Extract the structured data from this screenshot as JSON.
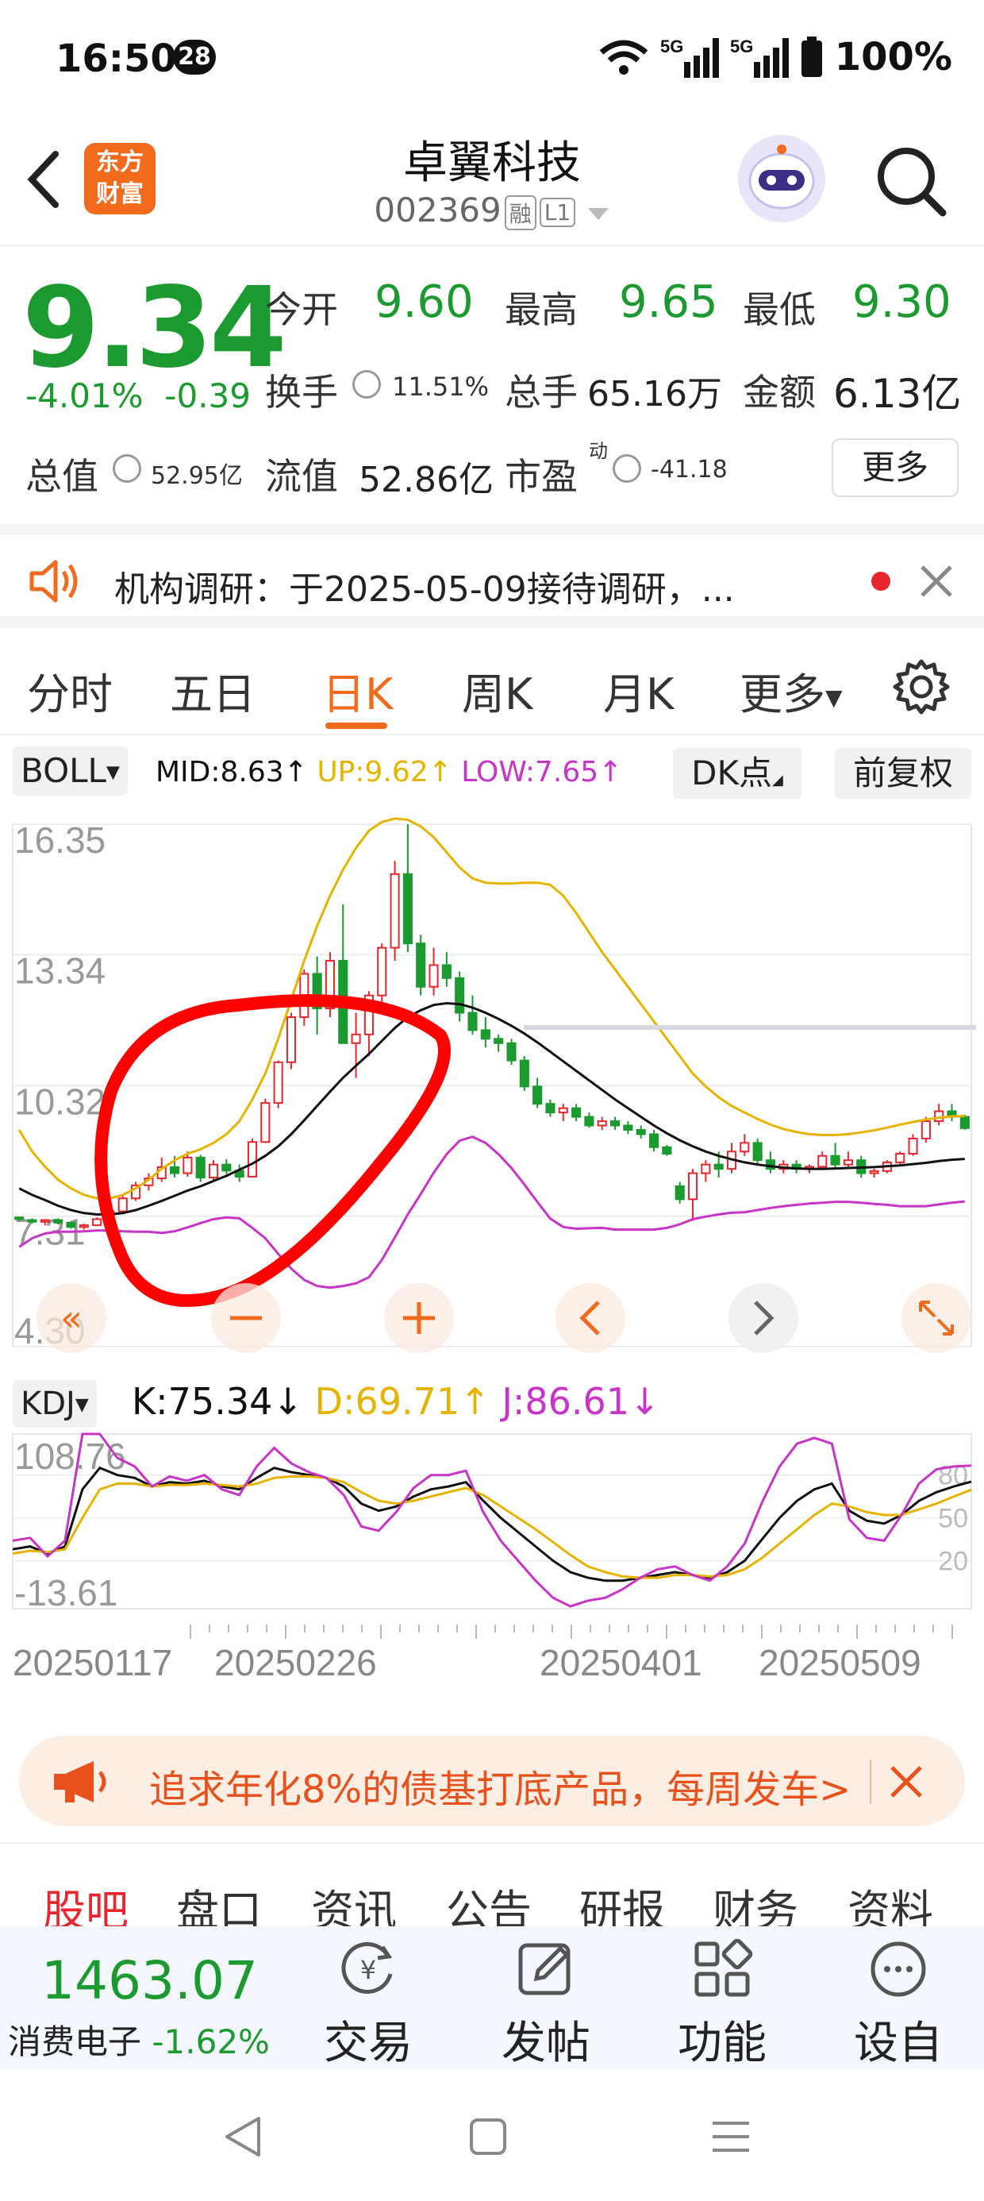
{
  "status": {
    "time": "16:50",
    "badge": "28",
    "network": "5G",
    "battery": "100%"
  },
  "header": {
    "title": "卓翼科技",
    "code": "002369",
    "tag_margin": "融",
    "tag_level": "L1",
    "logo_line1": "东方",
    "logo_line2": "财富"
  },
  "quote": {
    "price": "9.34",
    "change_pct": "-4.01%",
    "change": "-0.39",
    "open_label": "今开",
    "open": "9.60",
    "high_label": "最高",
    "high": "9.65",
    "low_label": "最低",
    "low": "9.30",
    "turnover_label": "换手",
    "turnover": "11.51%",
    "volume_label": "总手",
    "volume": "65.16万",
    "amount_label": "金额",
    "amount": "6.13亿",
    "mktcap_label": "总值",
    "mktcap": "52.95亿",
    "float_label": "流值",
    "float": "52.86亿",
    "pe_label": "市盈",
    "pe_sup": "动",
    "pe": "-41.18",
    "more": "更多"
  },
  "notice": {
    "text": "机构调研：于2025-05-09接待调研，..."
  },
  "tabs": [
    "分时",
    "五日",
    "日K",
    "周K",
    "月K",
    "更多"
  ],
  "indicator": {
    "name": "BOLL",
    "mid": "MID:8.63↑",
    "up": "UP:9.62↑",
    "low": "LOW:7.65↑",
    "dk": "DK点",
    "adjust": "前复权",
    "colors": {
      "mid": "#111111",
      "up": "#e6b400",
      "low": "#c833c8",
      "up_candle": "#e8262e",
      "down_candle": "#1a9a2f"
    }
  },
  "kdj": {
    "name": "KDJ",
    "k": "K:75.34↓",
    "d": "D:69.71↑",
    "j": "J:86.61↓"
  },
  "chart_data": [
    {
      "type": "candlestick",
      "indicator": "BOLL",
      "y_tick_labels": [
        "16.35",
        "13.34",
        "10.32",
        "7.31",
        "4.30"
      ],
      "ylim": [
        4.3,
        16.35
      ],
      "x_tick_labels": [
        "20250117",
        "20250226",
        "20250401",
        "20250509"
      ],
      "ohlc": [
        [
          7.28,
          7.3,
          7.2,
          7.25
        ],
        [
          7.22,
          7.26,
          7.14,
          7.18
        ],
        [
          7.18,
          7.24,
          7.1,
          7.22
        ],
        [
          7.22,
          7.26,
          7.12,
          7.16
        ],
        [
          7.16,
          7.2,
          7.02,
          7.06
        ],
        [
          7.06,
          7.14,
          7.0,
          7.1
        ],
        [
          7.1,
          7.28,
          7.08,
          7.24
        ],
        [
          7.24,
          7.48,
          7.2,
          7.42
        ],
        [
          7.42,
          7.8,
          7.38,
          7.72
        ],
        [
          7.72,
          8.1,
          7.66,
          8.02
        ],
        [
          8.02,
          8.3,
          7.9,
          8.18
        ],
        [
          8.18,
          8.66,
          8.1,
          8.44
        ],
        [
          8.44,
          8.7,
          8.2,
          8.3
        ],
        [
          8.3,
          8.8,
          8.22,
          8.66
        ],
        [
          8.66,
          8.72,
          8.1,
          8.2
        ],
        [
          8.2,
          8.6,
          8.1,
          8.5
        ],
        [
          8.5,
          8.62,
          8.28,
          8.36
        ],
        [
          8.36,
          8.5,
          8.1,
          8.22
        ],
        [
          8.22,
          9.1,
          8.2,
          9.02
        ],
        [
          9.02,
          10.02,
          9.0,
          9.92
        ],
        [
          9.92,
          10.9,
          9.8,
          10.86
        ],
        [
          10.86,
          12.0,
          10.7,
          11.9
        ],
        [
          11.9,
          13.0,
          11.7,
          12.9
        ],
        [
          12.9,
          13.3,
          11.5,
          12.1
        ],
        [
          12.1,
          13.4,
          11.9,
          13.2
        ],
        [
          13.2,
          14.5,
          11.3,
          11.3
        ],
        [
          11.3,
          12.0,
          10.5,
          11.5
        ],
        [
          11.5,
          12.5,
          11.0,
          12.4
        ],
        [
          12.4,
          13.6,
          12.2,
          13.5
        ],
        [
          13.5,
          15.5,
          13.2,
          15.2
        ],
        [
          15.2,
          16.35,
          13.4,
          13.6
        ],
        [
          13.6,
          13.8,
          12.4,
          12.6
        ],
        [
          12.6,
          13.5,
          12.4,
          13.1
        ],
        [
          13.1,
          13.4,
          12.6,
          12.8
        ],
        [
          12.8,
          12.95,
          11.8,
          12.0
        ],
        [
          12.0,
          12.4,
          11.5,
          11.6
        ],
        [
          11.6,
          11.9,
          11.2,
          11.4
        ],
        [
          11.4,
          11.5,
          11.1,
          11.3
        ],
        [
          11.3,
          11.4,
          10.8,
          10.9
        ],
        [
          10.9,
          11.0,
          10.2,
          10.3
        ],
        [
          10.3,
          10.5,
          9.8,
          9.9
        ],
        [
          9.9,
          10.0,
          9.6,
          9.7
        ],
        [
          9.7,
          9.9,
          9.5,
          9.8
        ],
        [
          9.8,
          9.9,
          9.5,
          9.6
        ],
        [
          9.6,
          9.7,
          9.35,
          9.4
        ],
        [
          9.4,
          9.6,
          9.3,
          9.5
        ],
        [
          9.5,
          9.6,
          9.3,
          9.4
        ],
        [
          9.4,
          9.5,
          9.2,
          9.3
        ],
        [
          9.3,
          9.4,
          9.1,
          9.2
        ],
        [
          9.2,
          9.3,
          8.8,
          8.9
        ],
        [
          8.9,
          8.95,
          8.7,
          8.75
        ],
        [
          8.0,
          8.1,
          7.6,
          7.7
        ],
        [
          7.7,
          8.4,
          7.2,
          8.3
        ],
        [
          8.3,
          8.6,
          8.1,
          8.5
        ],
        [
          8.5,
          8.8,
          8.2,
          8.4
        ],
        [
          8.4,
          9.0,
          8.3,
          8.8
        ],
        [
          8.8,
          9.2,
          8.7,
          9.0
        ],
        [
          9.0,
          9.1,
          8.5,
          8.6
        ],
        [
          8.6,
          8.8,
          8.3,
          8.4
        ],
        [
          8.4,
          8.6,
          8.3,
          8.5
        ],
        [
          8.5,
          8.6,
          8.3,
          8.4
        ],
        [
          8.4,
          8.5,
          8.3,
          8.45
        ],
        [
          8.45,
          8.8,
          8.4,
          8.7
        ],
        [
          8.7,
          9.0,
          8.4,
          8.5
        ],
        [
          8.5,
          8.8,
          8.4,
          8.6
        ],
        [
          8.6,
          8.7,
          8.2,
          8.3
        ],
        [
          8.3,
          8.4,
          8.2,
          8.35
        ],
        [
          8.35,
          8.6,
          8.3,
          8.55
        ],
        [
          8.55,
          8.8,
          8.5,
          8.75
        ],
        [
          8.75,
          9.2,
          8.7,
          9.1
        ],
        [
          9.1,
          9.6,
          9.0,
          9.5
        ],
        [
          9.5,
          9.9,
          9.4,
          9.73
        ],
        [
          9.73,
          9.9,
          9.5,
          9.6
        ],
        [
          9.6,
          9.65,
          9.3,
          9.34
        ]
      ],
      "boll_mid": [
        7.95,
        7.8,
        7.68,
        7.55,
        7.45,
        7.38,
        7.35,
        7.35,
        7.38,
        7.45,
        7.55,
        7.66,
        7.78,
        7.9,
        8.0,
        8.12,
        8.24,
        8.38,
        8.52,
        8.7,
        8.92,
        9.2,
        9.52,
        9.85,
        10.18,
        10.5,
        10.78,
        11.05,
        11.35,
        11.65,
        11.9,
        12.06,
        12.18,
        12.22,
        12.2,
        12.12,
        12.0,
        11.86,
        11.7,
        11.52,
        11.32,
        11.1,
        10.88,
        10.66,
        10.44,
        10.22,
        10.0,
        9.8,
        9.6,
        9.4,
        9.22,
        9.06,
        8.92,
        8.8,
        8.7,
        8.62,
        8.55,
        8.5,
        8.46,
        8.43,
        8.41,
        8.4,
        8.4,
        8.41,
        8.42,
        8.43,
        8.44,
        8.46,
        8.48,
        8.51,
        8.54,
        8.58,
        8.61,
        8.63
      ],
      "boll_up": [
        9.3,
        8.8,
        8.45,
        8.15,
        7.95,
        7.8,
        7.72,
        7.72,
        7.8,
        7.95,
        8.15,
        8.4,
        8.6,
        8.75,
        8.85,
        9.0,
        9.2,
        9.5,
        10.0,
        10.6,
        11.4,
        12.3,
        13.2,
        14.0,
        14.7,
        15.3,
        15.8,
        16.2,
        16.4,
        16.48,
        16.45,
        16.3,
        16.05,
        15.7,
        15.35,
        15.1,
        15.0,
        14.98,
        14.98,
        15.0,
        15.0,
        14.95,
        14.7,
        14.3,
        13.85,
        13.4,
        13.0,
        12.6,
        12.2,
        11.8,
        11.4,
        11.0,
        10.6,
        10.3,
        10.05,
        9.85,
        9.7,
        9.55,
        9.42,
        9.32,
        9.25,
        9.2,
        9.18,
        9.18,
        9.2,
        9.24,
        9.29,
        9.35,
        9.42,
        9.48,
        9.54,
        9.58,
        9.61,
        9.62
      ],
      "boll_low": [
        6.6,
        6.8,
        6.91,
        6.95,
        6.95,
        6.96,
        6.98,
        6.98,
        6.96,
        6.95,
        6.95,
        6.92,
        6.96,
        7.05,
        7.15,
        7.24,
        7.28,
        7.26,
        7.04,
        6.8,
        6.44,
        6.1,
        5.84,
        5.7,
        5.66,
        5.7,
        5.76,
        5.9,
        6.3,
        6.82,
        7.35,
        7.82,
        8.31,
        8.74,
        9.05,
        9.14,
        9.0,
        8.74,
        8.42,
        8.04,
        7.64,
        7.25,
        7.06,
        7.02,
        7.03,
        7.04,
        7.0,
        7.0,
        7.0,
        7.0,
        7.04,
        7.12,
        7.24,
        7.3,
        7.35,
        7.39,
        7.4,
        7.45,
        7.5,
        7.54,
        7.57,
        7.6,
        7.62,
        7.64,
        7.64,
        7.62,
        7.59,
        7.57,
        7.54,
        7.54,
        7.54,
        7.58,
        7.62,
        7.65
      ]
    },
    {
      "type": "line",
      "indicator": "KDJ",
      "y_tick_labels": [
        "108.76",
        "-13.61"
      ],
      "ylim": [
        -13.61,
        108.76
      ],
      "right_tick_labels": [
        "80",
        "50",
        "20"
      ],
      "series": [
        {
          "name": "K",
          "values": [
            28,
            30,
            25,
            30,
            70,
            85,
            80,
            78,
            72,
            75,
            74,
            76,
            72,
            70,
            78,
            85,
            82,
            80,
            78,
            72,
            60,
            55,
            58,
            65,
            70,
            72,
            75,
            62,
            50,
            40,
            30,
            20,
            12,
            8,
            6,
            6,
            8,
            10,
            12,
            10,
            8,
            12,
            20,
            35,
            50,
            62,
            70,
            74,
            55,
            48,
            46,
            52,
            62,
            68,
            72,
            75.34
          ]
        },
        {
          "name": "D",
          "values": [
            25,
            27,
            26,
            28,
            50,
            70,
            74,
            74,
            72,
            73,
            73,
            74,
            73,
            72,
            74,
            78,
            79,
            79,
            78,
            75,
            68,
            62,
            60,
            62,
            65,
            68,
            71,
            66,
            58,
            50,
            42,
            33,
            24,
            16,
            12,
            9,
            8,
            8,
            10,
            10,
            9,
            10,
            14,
            22,
            32,
            42,
            52,
            60,
            58,
            54,
            52,
            52,
            56,
            60,
            65,
            69.71
          ]
        },
        {
          "name": "J",
          "values": [
            34,
            36,
            23,
            34,
            110,
            115,
            92,
            86,
            72,
            79,
            76,
            80,
            70,
            66,
            86,
            99,
            88,
            82,
            78,
            66,
            44,
            41,
            54,
            71,
            80,
            80,
            83,
            54,
            34,
            20,
            6,
            -6,
            -12,
            -8,
            -6,
            0,
            8,
            14,
            16,
            10,
            6,
            16,
            32,
            61,
            86,
            102,
            106,
            102,
            49,
            36,
            34,
            52,
            74,
            84,
            86,
            86.61
          ]
        }
      ]
    }
  ],
  "banner": {
    "text": "追求年化8%的债基打底产品，每周发车>"
  },
  "bottom_tabs": [
    "股吧",
    "盘口",
    "资讯",
    "公告",
    "研报",
    "财务",
    "资料"
  ],
  "bottom_bar": {
    "index_value": "1463.07",
    "index_name": "消费电子",
    "index_change": "-1.62%",
    "trade": "交易",
    "post": "发帖",
    "function": "功能",
    "watchlist": "设自选"
  }
}
